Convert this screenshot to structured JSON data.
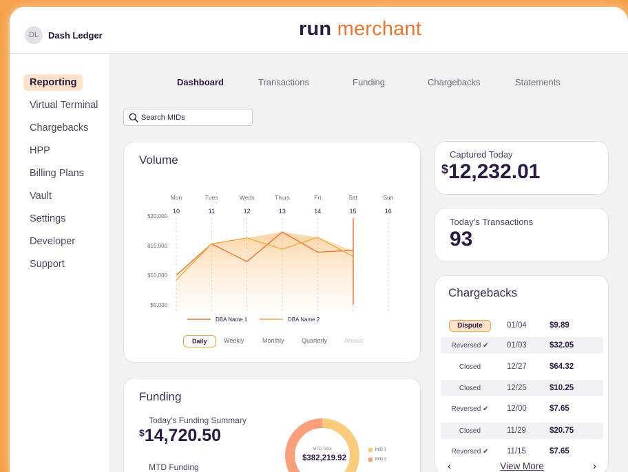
{
  "user": {
    "initials": "DL",
    "name": "Dash Ledger"
  },
  "brand": {
    "part1": "run",
    "part2": "merchant"
  },
  "sidebar": {
    "items": [
      {
        "label": "Reporting",
        "active": true
      },
      {
        "label": "Virtual Terminal"
      },
      {
        "label": "Chargebacks"
      },
      {
        "label": "HPP"
      },
      {
        "label": "Billing Plans"
      },
      {
        "label": "Vault"
      },
      {
        "label": "Settings"
      },
      {
        "label": "Developer"
      },
      {
        "label": "Support"
      }
    ]
  },
  "tabs": [
    {
      "label": "Dashboard",
      "active": true
    },
    {
      "label": "Transactions"
    },
    {
      "label": "Funding"
    },
    {
      "label": "Chargebacks"
    },
    {
      "label": "Statements"
    }
  ],
  "search": {
    "placeholder": "Search MIDs",
    "icon": "search-icon"
  },
  "volume": {
    "title": "Volume",
    "ranges": [
      "Daily",
      "Weekly",
      "Monthly",
      "Quarterly",
      "Annual"
    ],
    "active_range": "Daily",
    "disabled_range": "Annual"
  },
  "chart_data": {
    "type": "area",
    "categories": [
      "Mon",
      "Tues",
      "Weds",
      "Thurs",
      "Fri",
      "Sat",
      "Sun"
    ],
    "dates": [
      "10",
      "11",
      "12",
      "13",
      "14",
      "15",
      "16"
    ],
    "y_ticks": [
      "$20,000",
      "$15,000",
      "$10,000",
      "$5,000"
    ],
    "ylim": [
      0,
      20000
    ],
    "series": [
      {
        "name": "DBA Name 1",
        "color": "#f0732a",
        "values": [
          10000,
          15300,
          12300,
          17300,
          13900,
          14200,
          null
        ]
      },
      {
        "name": "DBA Name 2",
        "color": "#f4a93b",
        "values": [
          9200,
          15300,
          16300,
          14400,
          16400,
          13200,
          null
        ]
      }
    ],
    "marker_day": "Sat"
  },
  "captured_today": {
    "label": "Captured Today",
    "currency": "$",
    "value": "12,232.01"
  },
  "todays_transactions": {
    "label": "Today’s Transactions",
    "value": "93"
  },
  "chargebacks": {
    "title": "Chargebacks",
    "rows": [
      {
        "status": "Dispute",
        "date": "01/04",
        "amount": "$9.89"
      },
      {
        "status": "Reversed ✔",
        "date": "01/03",
        "amount": "$32.05"
      },
      {
        "status": "Closed",
        "date": "12/27",
        "amount": "$64.32"
      },
      {
        "status": "Closed",
        "date": "12/25",
        "amount": "$10.25"
      },
      {
        "status": "Reversed ✔",
        "date": "12/00",
        "amount": "$7.65"
      },
      {
        "status": "Closed",
        "date": "11/29",
        "amount": "$20.75"
      },
      {
        "status": "Reversed ✔",
        "date": "11/15",
        "amount": "$7.65"
      }
    ],
    "prev": "‹",
    "next": "›",
    "view_more": "View More"
  },
  "funding": {
    "title": "Funding",
    "summary_label": "Today’s Funding Summary",
    "currency": "$",
    "summary_value": "14,720.50",
    "mtd_label": "MTD Funding",
    "donut": {
      "center_label": "MTD Total",
      "center_value": "$382,219.92",
      "slices": [
        {
          "name": "MID 1",
          "share": 0.5,
          "color": "#fbcb7c"
        },
        {
          "name": "MID 2",
          "share": 0.5,
          "color": "#f9a07a"
        }
      ]
    }
  }
}
